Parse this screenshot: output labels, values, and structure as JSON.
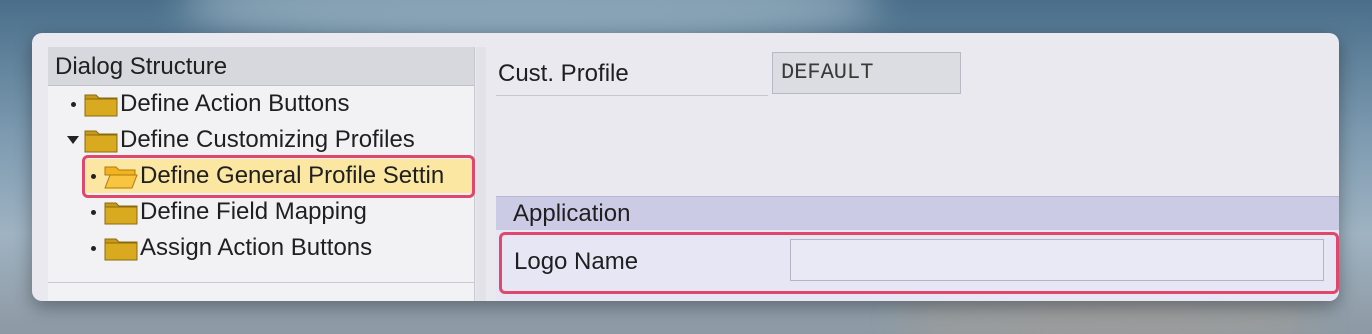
{
  "dialog_structure": {
    "title": "Dialog Structure",
    "items": [
      {
        "label": "Define Action Buttons",
        "level": 0,
        "expanded": false,
        "selected": false
      },
      {
        "label": "Define Customizing Profiles",
        "level": 0,
        "expanded": true,
        "selected": false
      },
      {
        "label": "Define General Profile Settin",
        "level": 1,
        "expanded": false,
        "selected": true
      },
      {
        "label": "Define Field Mapping",
        "level": 1,
        "expanded": false,
        "selected": false
      },
      {
        "label": "Assign Action Buttons",
        "level": 1,
        "expanded": false,
        "selected": false
      }
    ]
  },
  "header": {
    "cust_profile_label": "Cust. Profile",
    "cust_profile_value": "DEFAULT"
  },
  "application": {
    "section_title": "Application",
    "logo_name_label": "Logo Name",
    "logo_name_value": ""
  },
  "colors": {
    "highlight": "#e0476d",
    "selected_row": "#fbe7a1",
    "folder": "#c99a1a"
  },
  "icons": {
    "folder": "folder-icon",
    "folder_open": "folder-open-icon",
    "bullet": "bullet-icon",
    "expand": "expand-triangle-icon"
  }
}
